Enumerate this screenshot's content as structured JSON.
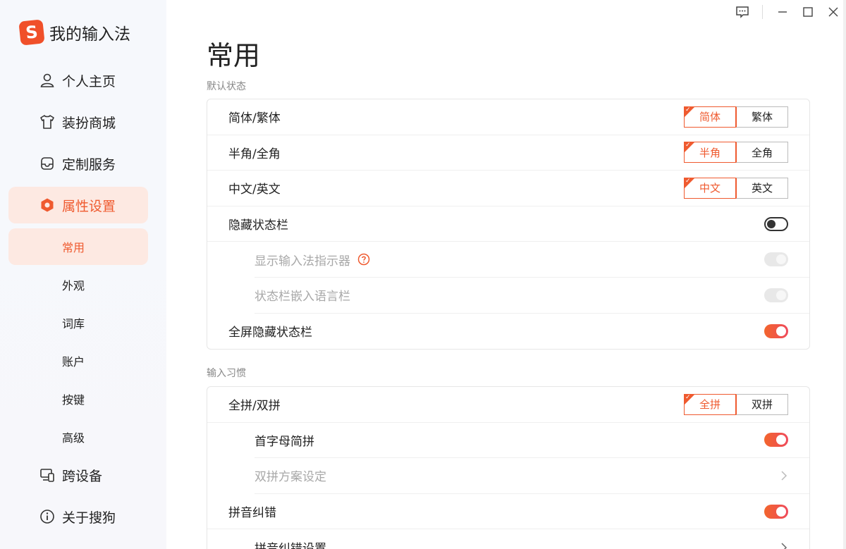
{
  "app": {
    "logo_letter": "S",
    "title": "我的输入法"
  },
  "nav": {
    "items": [
      {
        "label": "个人主页",
        "icon": "person-icon"
      },
      {
        "label": "装扮商城",
        "icon": "shirt-icon"
      },
      {
        "label": "定制服务",
        "icon": "inbox-icon"
      },
      {
        "label": "属性设置",
        "icon": "hexagon-gear-icon"
      }
    ],
    "sub_items": [
      "常用",
      "外观",
      "词库",
      "账户",
      "按键",
      "高级"
    ],
    "bottom_items": [
      {
        "label": "跨设备",
        "icon": "devices-icon"
      },
      {
        "label": "关于搜狗",
        "icon": "info-icon"
      }
    ]
  },
  "page": {
    "title": "常用"
  },
  "sections": {
    "default_state": {
      "label": "默认状态",
      "rows": {
        "simp_trad": {
          "label": "简体/繁体",
          "options": [
            "简体",
            "繁体"
          ],
          "selected": 0
        },
        "half_full": {
          "label": "半角/全角",
          "options": [
            "半角",
            "全角"
          ],
          "selected": 0
        },
        "cn_en": {
          "label": "中文/英文",
          "options": [
            "中文",
            "英文"
          ],
          "selected": 0
        },
        "hide_status": {
          "label": "隐藏状态栏",
          "value": "off"
        },
        "show_indicator": {
          "label": "显示输入法指示器",
          "value": "disabled"
        },
        "embed_lang": {
          "label": "状态栏嵌入语言栏",
          "value": "disabled"
        },
        "fullscreen_hide": {
          "label": "全屏隐藏状态栏",
          "value": "on"
        }
      }
    },
    "input_habits": {
      "label": "输入习惯",
      "rows": {
        "pinyin_mode": {
          "label": "全拼/双拼",
          "options": [
            "全拼",
            "双拼"
          ],
          "selected": 0
        },
        "initial_abbr": {
          "label": "首字母简拼",
          "value": "on"
        },
        "shuangpin_scheme": {
          "label": "双拼方案设定"
        },
        "pinyin_correct": {
          "label": "拼音纠错",
          "value": "on"
        },
        "pinyin_correct_settings": {
          "label": "拼音纠错设置"
        }
      }
    }
  },
  "colors": {
    "accent": "#ef5a2f",
    "active_bg": "#fde9e2"
  }
}
